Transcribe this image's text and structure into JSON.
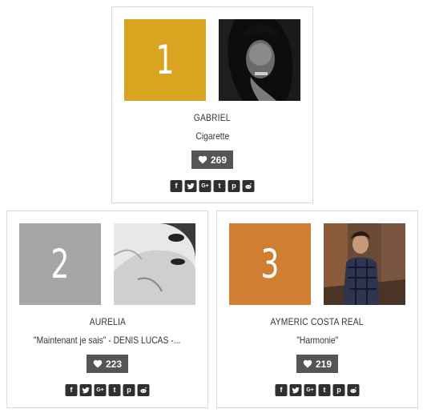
{
  "colors": {
    "gold": "#d9a520",
    "silver": "#a6a6a6",
    "bronze": "#d07f32",
    "badge": "#555555",
    "icon": "#2f2f2f"
  },
  "entries": [
    {
      "rank": "1",
      "artist": "GABRIEL",
      "title": "Cigarette",
      "likes": "269"
    },
    {
      "rank": "2",
      "artist": "AURELIA",
      "title": "\"Maintenant je sais\" - DENIS LUCAS -...",
      "likes": "223"
    },
    {
      "rank": "3",
      "artist": "AYMERIC COSTA REAL",
      "title": "\"Harmonie\"",
      "likes": "219"
    }
  ],
  "share_icons": [
    "facebook-icon",
    "twitter-icon",
    "google-plus-icon",
    "tumblr-icon",
    "pinterest-icon",
    "reddit-icon"
  ],
  "share_glyphs": {
    "facebook": "f",
    "google_plus": "G+",
    "tumblr": "t",
    "pinterest": "p"
  }
}
